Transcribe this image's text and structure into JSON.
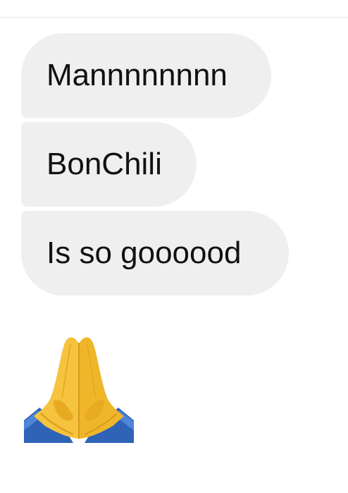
{
  "messages": [
    {
      "text": "Mannnnnnnn"
    },
    {
      "text": "BonChili"
    },
    {
      "text": "Is so goooood"
    }
  ],
  "emoji": {
    "icon": "folded-hands-icon"
  },
  "colors": {
    "bubble_bg": "#efefef",
    "text": "#111111",
    "divider": "#e4e4e6",
    "background": "#ffffff"
  }
}
